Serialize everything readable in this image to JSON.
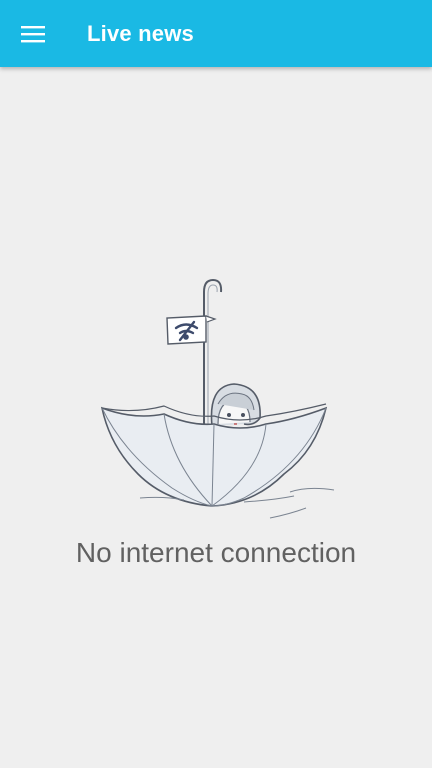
{
  "app_bar": {
    "title": "Live news",
    "menu_icon": "hamburger-menu-icon",
    "background_color": "#1ab9e4"
  },
  "empty_state": {
    "illustration": "umbrella-boat-girl-no-wifi-illustration",
    "message": "No internet connection"
  }
}
